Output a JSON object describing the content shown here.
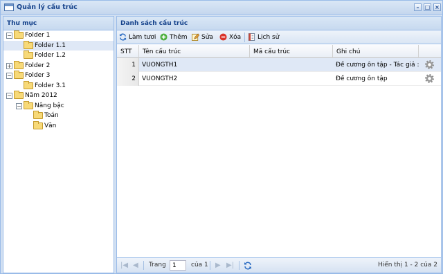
{
  "window": {
    "title": "Quản lý cấu trúc"
  },
  "left_panel": {
    "title": "Thư mục",
    "tree": [
      {
        "label": "Folder 1",
        "expander": "−"
      },
      {
        "label": "Folder 1.1",
        "expander": ""
      },
      {
        "label": "Folder 1.2",
        "expander": ""
      },
      {
        "label": "Folder 2",
        "expander": "+"
      },
      {
        "label": "Folder 3",
        "expander": "−"
      },
      {
        "label": "Folder 3.1",
        "expander": ""
      },
      {
        "label": "Năm 2012",
        "expander": "−"
      },
      {
        "label": "Nâng bậc",
        "expander": "−"
      },
      {
        "label": "Toán",
        "expander": ""
      },
      {
        "label": "Văn",
        "expander": ""
      }
    ]
  },
  "right_panel": {
    "title": "Danh sách cấu trúc",
    "toolbar": {
      "refresh": "Làm tươi",
      "add": "Thêm",
      "edit": "Sửa",
      "delete": "Xóa",
      "history": "Lịch sử"
    },
    "columns": [
      "STT",
      "Tên cấu trúc",
      "Mã cấu trúc",
      "Ghi chú"
    ],
    "rows": [
      {
        "stt": "1",
        "name": "VUONGTH1",
        "code": "",
        "note": "Đề cương ôn tập - Tác giả :..."
      },
      {
        "stt": "2",
        "name": "VUONGTH2",
        "code": "",
        "note": "Đề cương ôn tập"
      }
    ],
    "pager": {
      "page_label": "Trang",
      "page_value": "1",
      "of_label": "của 1",
      "display_info": "Hiển thị 1 - 2 của 2"
    }
  }
}
